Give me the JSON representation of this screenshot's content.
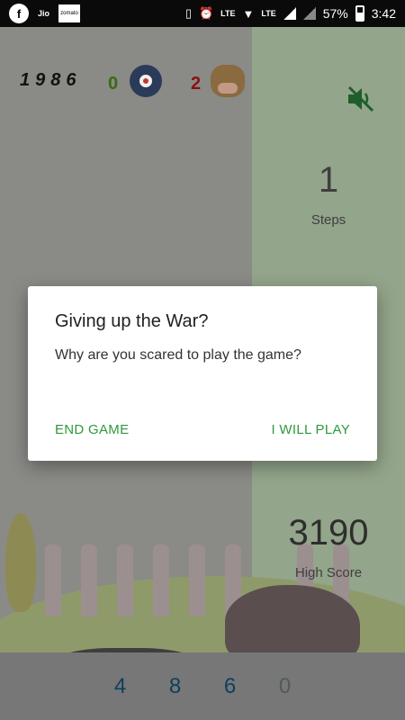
{
  "status_bar": {
    "jio_label": "Jio",
    "zomato_label": "zomato",
    "lte_label": "LTE",
    "battery_percent": "57%",
    "time": "3:42"
  },
  "game": {
    "year": "1986",
    "bull_score": "0",
    "cow_score": "2",
    "steps_value": "1",
    "steps_label": "Steps",
    "high_score_value": "3190",
    "high_score_label": "High Score",
    "sound_state": "muted"
  },
  "keypad": {
    "digits": [
      "4",
      "8",
      "6",
      "0"
    ]
  },
  "dialog": {
    "title": "Giving up the War?",
    "message": "Why are you scared to play the game?",
    "negative_button": "END GAME",
    "positive_button": "I WILL PLAY"
  },
  "colors": {
    "accent_green": "#2e9a3a",
    "bull_score_color": "#3a6b10",
    "cow_score_color": "#8b1010",
    "keypad_digit_color": "#0d3f5e"
  }
}
